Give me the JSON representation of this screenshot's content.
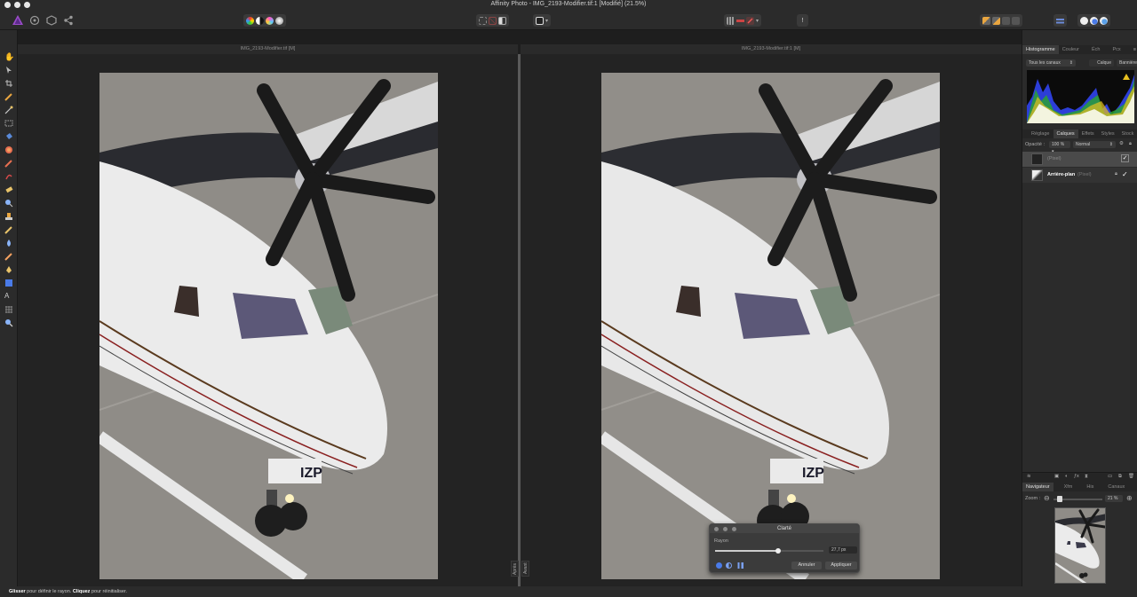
{
  "window": {
    "title": "Affinity Photo - IMG_2193-Modifier.tif:1 [Modifié] (21.5%)"
  },
  "documents": {
    "left_tab": "IMG_2193-Modifier.tif [M]",
    "right_tab": "IMG_2193-Modifier.tif:1 [M]",
    "left_label": "Après",
    "right_label": "Avant",
    "photo_caption": "IZP"
  },
  "panels": {
    "top_tabs": [
      "Histogramme",
      "Couleur",
      "Éch",
      "Pcx"
    ],
    "channel_select": "Tous les canaux",
    "calque_btn": "Calque",
    "banner_btn": "Bannière",
    "layer_tabs": [
      "Réglage",
      "Calques",
      "Effets",
      "Styles",
      "Stock"
    ],
    "opacity_label": "Opacité :",
    "opacity_value": "100 %",
    "blend_mode": "Normal",
    "layers": [
      {
        "name": "(Pixel)",
        "sub": ""
      },
      {
        "name": "Arrière-plan",
        "sub": "(Pixel)"
      }
    ],
    "nav_tabs": [
      "Navigateur",
      "Xfm",
      "His",
      "Canaux"
    ],
    "zoom_label": "Zoom :",
    "zoom_value": "21 %"
  },
  "dialog": {
    "title": "Clarté",
    "radius_label": "Rayon",
    "radius_value": "27,7 px",
    "radius_fraction": 0.58,
    "cancel": "Annuler",
    "apply": "Appliquer"
  },
  "status": {
    "drag": "Glisser",
    "drag_text": " pour définir le rayon. ",
    "click": "Cliquez",
    "click_text": " pour réinitialiser."
  }
}
